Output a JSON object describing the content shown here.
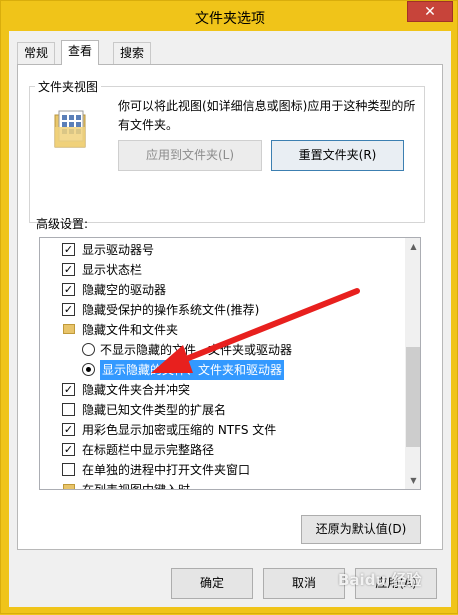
{
  "window": {
    "title": "文件夹选项",
    "close_glyph": "✕"
  },
  "tabs": [
    {
      "label": "常规"
    },
    {
      "label": "查看"
    },
    {
      "label": "搜索"
    }
  ],
  "folder_view": {
    "legend": "文件夹视图",
    "description": "你可以将此视图(如详细信息或图标)应用于这种类型的所有文件夹。",
    "apply_button": "应用到文件夹(L)",
    "reset_button": "重置文件夹(R)"
  },
  "advanced": {
    "label": "高级设置:",
    "items": [
      {
        "type": "checkbox",
        "checked": true,
        "label": "显示驱动器号"
      },
      {
        "type": "checkbox",
        "checked": true,
        "label": "显示状态栏"
      },
      {
        "type": "checkbox",
        "checked": true,
        "label": "隐藏空的驱动器"
      },
      {
        "type": "checkbox",
        "checked": true,
        "label": "隐藏受保护的操作系统文件(推荐)"
      },
      {
        "type": "folder",
        "label": "隐藏文件和文件夹"
      },
      {
        "type": "radio",
        "checked": false,
        "label": "不显示隐藏的文件、文件夹或驱动器"
      },
      {
        "type": "radio",
        "checked": true,
        "selected": true,
        "label": "显示隐藏的文件、文件夹和驱动器"
      },
      {
        "type": "checkbox",
        "checked": true,
        "label": "隐藏文件夹合并冲突"
      },
      {
        "type": "checkbox",
        "checked": false,
        "label": "隐藏已知文件类型的扩展名"
      },
      {
        "type": "checkbox",
        "checked": true,
        "label": "用彩色显示加密或压缩的 NTFS 文件"
      },
      {
        "type": "checkbox",
        "checked": true,
        "label": "在标题栏中显示完整路径"
      },
      {
        "type": "checkbox",
        "checked": false,
        "label": "在单独的进程中打开文件夹窗口"
      },
      {
        "type": "folder",
        "label": "在列表视图中键入时"
      }
    ],
    "restore_button": "还原为默认值(D)"
  },
  "footer": {
    "ok": "确定",
    "cancel": "取消",
    "apply": "应用(A)"
  },
  "watermark": "Baidu 经验",
  "colors": {
    "title_bar": "#f0c419",
    "close": "#c7443a",
    "selection": "#3399ff",
    "annotation_arrow": "#e8201e"
  }
}
